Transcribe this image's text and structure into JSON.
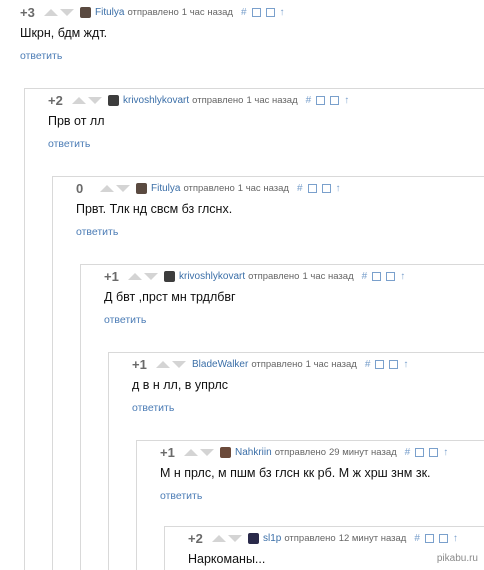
{
  "comments": [
    {
      "score": "+3",
      "author": "Fitulya",
      "sent": "отправлено",
      "time": "1 час назад",
      "text": "Шкрн, бдм ждт.",
      "reply": "ответить",
      "avatar": "#5a4a40"
    },
    {
      "score": "+2",
      "author": "krivoshlykovart",
      "sent": "отправлено",
      "time": "1 час назад",
      "text": "Прв от лл",
      "reply": "ответить",
      "avatar": "#3d3d3d"
    },
    {
      "score": "0",
      "author": "Fitulya",
      "sent": "отправлено",
      "time": "1 час назад",
      "text": "Првт. Тлк нд свсм бз глснх.",
      "reply": "ответить",
      "avatar": "#5a4a40"
    },
    {
      "score": "+1",
      "author": "krivoshlykovart",
      "sent": "отправлено",
      "time": "1 час назад",
      "text": "Д бвт ,прст мн трдлбвг",
      "reply": "ответить",
      "avatar": "#3d3d3d"
    },
    {
      "score": "+1",
      "author": "BladeWalker",
      "sent": "отправлено",
      "time": "1 час назад",
      "text": "д в н лл, в упрлс",
      "reply": "ответить",
      "avatar": ""
    },
    {
      "score": "+1",
      "author": "Nahkriin",
      "sent": "отправлено",
      "time": "29 минут назад",
      "text": "М н прлс, м пшм бз глсн кк рб. М ж хрш знм зк.",
      "reply": "ответить",
      "avatar": "#6b4a3a"
    },
    {
      "score": "+2",
      "author": "sl1p",
      "sent": "отправлено",
      "time": "12 минут назад",
      "text": "Наркоманы...",
      "reply": "",
      "avatar": "#2a2a4a"
    }
  ],
  "tools": {
    "hash": "#",
    "up": "↑"
  },
  "watermark": "pikabu.ru",
  "colors": {
    "author": "#3b6fa8",
    "reply": "#4a7bb5",
    "arrow": "#d4d4d4"
  }
}
